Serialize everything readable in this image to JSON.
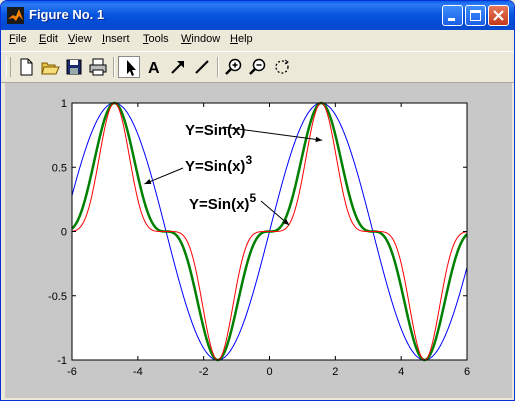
{
  "window": {
    "title": "Figure No. 1",
    "controls": [
      "minimize",
      "maximize",
      "close"
    ]
  },
  "menu": [
    {
      "label": "File",
      "underline": "F"
    },
    {
      "label": "Edit",
      "underline": "E"
    },
    {
      "label": "View",
      "underline": "V"
    },
    {
      "label": "Insert",
      "underline": "I"
    },
    {
      "label": "Tools",
      "underline": "T"
    },
    {
      "label": "Window",
      "underline": "W"
    },
    {
      "label": "Help",
      "underline": "H"
    }
  ],
  "toolbar": {
    "tools": [
      "new-file-icon",
      "open-folder-icon",
      "save-icon",
      "print-icon",
      "select-arrow-icon",
      "insert-text-icon",
      "insert-arrow-icon",
      "insert-line-icon",
      "zoom-in-icon",
      "zoom-out-icon",
      "rotate-3d-icon"
    ],
    "text_tool_glyph": "A",
    "pressed_tool": "select-arrow-icon"
  },
  "chart_data": {
    "type": "line",
    "title": "",
    "xlabel": "",
    "ylabel": "",
    "xlim": [
      -6,
      6
    ],
    "ylim": [
      -1,
      1
    ],
    "xticks": [
      -6,
      -4,
      -2,
      0,
      2,
      4,
      6
    ],
    "yticks": [
      -1,
      -0.5,
      0,
      0.5,
      1
    ],
    "ytick_labels": [
      "-1",
      "-0.5",
      "0",
      "0.5",
      "1"
    ],
    "grid": false,
    "colors": {
      "background": "#ffffff",
      "figure": "#c8c8c8"
    },
    "series": [
      {
        "name": "Y=Sin(x)",
        "function": "sin(x)",
        "exponent": 1,
        "color": "#0000ff",
        "width": 1
      },
      {
        "name": "Y=Sin(x)^3",
        "function": "sin(x)^3",
        "exponent": 3,
        "color": "#008000",
        "width": 2.5
      },
      {
        "name": "Y=Sin(x)^5",
        "function": "sin(x)^5",
        "exponent": 5,
        "color": "#ff0000",
        "width": 1
      }
    ],
    "annotations": [
      {
        "text": "Y=Sin(x)",
        "superscript": "",
        "arrow_to": [
          1.6,
          0.71
        ]
      },
      {
        "text": "Y=Sin(x)",
        "superscript": "3",
        "arrow_to": [
          -3.8,
          0.37
        ]
      },
      {
        "text": "Y=Sin(x)",
        "superscript": "5",
        "arrow_to": [
          0.6,
          0.05
        ]
      }
    ]
  }
}
